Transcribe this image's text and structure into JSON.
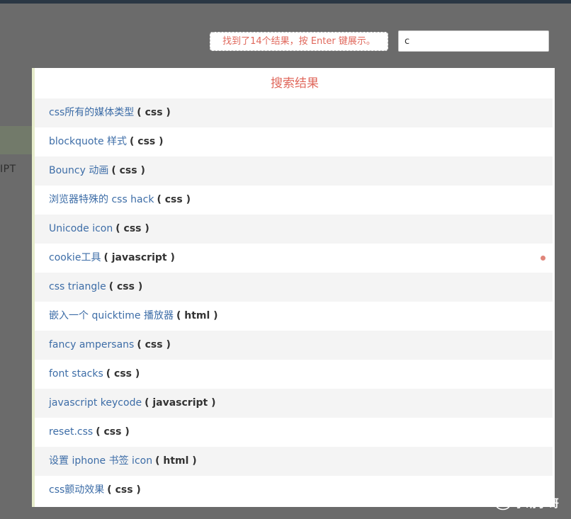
{
  "search": {
    "status_message": "找到了14个结果，按 Enter 键展示。",
    "query": "c"
  },
  "background": {
    "partial_text": "IPT"
  },
  "results_panel": {
    "title": "搜索结果",
    "items": [
      {
        "title": "css所有的媒体类型",
        "lang": "( css )"
      },
      {
        "title": "blockquote 样式",
        "lang": "( css )"
      },
      {
        "title": "Bouncy 动画",
        "lang": "( css )"
      },
      {
        "title": "浏览器特殊的 css hack",
        "lang": "( css )"
      },
      {
        "title": "Unicode icon",
        "lang": "( css )"
      },
      {
        "title": "cookie工具",
        "lang": "( javascript )"
      },
      {
        "title": "css triangle",
        "lang": "( css )"
      },
      {
        "title": "嵌入一个 quicktime 播放器",
        "lang": "( html )"
      },
      {
        "title": "fancy ampersans",
        "lang": "( css )"
      },
      {
        "title": "font stacks",
        "lang": "( css )"
      },
      {
        "title": "javascript keycode",
        "lang": "( javascript )"
      },
      {
        "title": "reset.css",
        "lang": "( css )"
      },
      {
        "title": "设置 iphone 书签 icon",
        "lang": "( html )"
      },
      {
        "title": "css颤动效果",
        "lang": "( css )"
      }
    ]
  },
  "watermark": {
    "text": "小胡子哥"
  },
  "colors": {
    "accent": "#e0685c",
    "link": "#3d6da7",
    "overlay": "#6b6b6b",
    "panel_border": "#e6eccb",
    "row_alt": "#f4f4f4"
  }
}
